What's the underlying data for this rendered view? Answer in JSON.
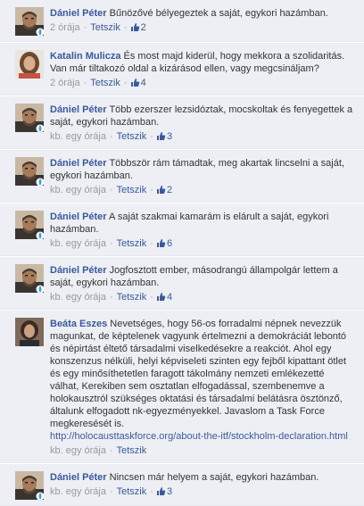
{
  "comments": [
    {
      "author": "Dániel Péter",
      "text": "Bűnözővé bélyegeztek a saját, egykori hazámban.",
      "time": "2 órája",
      "like_label": "Tetszik",
      "likes": "2",
      "avatar": "man-avatar",
      "badge": true
    },
    {
      "author": "Katalin Mulicza",
      "text": "És most majd kiderül, hogy mekkora a szolidaritás. Van már tiltakozó oldal a kizárásod ellen, vagy megcsináljam?",
      "time": "2 órája",
      "like_label": "Tetszik",
      "likes": "4",
      "avatar": "woman-avatar",
      "badge": false
    },
    {
      "author": "Dániel Péter",
      "text": "Több ezerszer lezsidóztak, mocskoltak és fenyegettek a saját, egykori hazámban.",
      "time": "kb. egy órája",
      "like_label": "Tetszik",
      "likes": "3",
      "avatar": "man-avatar",
      "badge": true
    },
    {
      "author": "Dániel Péter",
      "text": "Többször rám támadtak, meg akartak lincselni a saját, egykori hazámban.",
      "time": "kb. egy órája",
      "like_label": "Tetszik",
      "likes": "2",
      "avatar": "man-avatar",
      "badge": true
    },
    {
      "author": "Dániel Péter",
      "text": "A saját szakmai kamarám is elárult a saját, egykori hazámban.",
      "time": "kb. egy órája",
      "like_label": "Tetszik",
      "likes": "6",
      "avatar": "man-avatar",
      "badge": true
    },
    {
      "author": "Dániel Péter",
      "text": "Jogfosztott ember, másodrangú állampolgár lettem a saját, egykori hazámban.",
      "time": "kb. egy órája",
      "like_label": "Tetszik",
      "likes": "4",
      "avatar": "man-avatar",
      "badge": true
    },
    {
      "author": "Beáta Eszes",
      "text": "Nevetséges, hogy 56-os forradalmi népnek nevezzük magunkat, de képtelenek vagyunk értelmezni a demokráciát lebontó és népirtást éltető társadalmi viselkedésekre a reakciót. Ahol egy konszenzus nélküli, helyi képviseleti szinten egy fejből kipattant ötlet és egy minősíthetetlen faragott tákolmány nemzeti emlékezetté válhat, Kerekiben sem osztatlan elfogadással, szembenemve a holokausztról szükséges oktatási és társadalmi belátásra ösztönző, általunk elfogadott nk-egyezményekkel. Javaslom a Task Force megkeresését is.",
      "link": "http://holocausttaskforce.org/about-the-itf/stockholm-declaration.html",
      "time": "kb. egy órája",
      "like_label": "Tetszik",
      "likes": "",
      "avatar": "woman2-avatar",
      "badge": false
    },
    {
      "author": "Dániel Péter",
      "text": "Nincsen már helyem a saját, egykori hazámban.",
      "time": "kb. egy órája",
      "like_label": "Tetszik",
      "likes": "3",
      "avatar": "man-avatar",
      "badge": true
    }
  ],
  "colors": {
    "author": "#3b5998",
    "comment_bg": "#edeff4",
    "meta": "#999999"
  }
}
